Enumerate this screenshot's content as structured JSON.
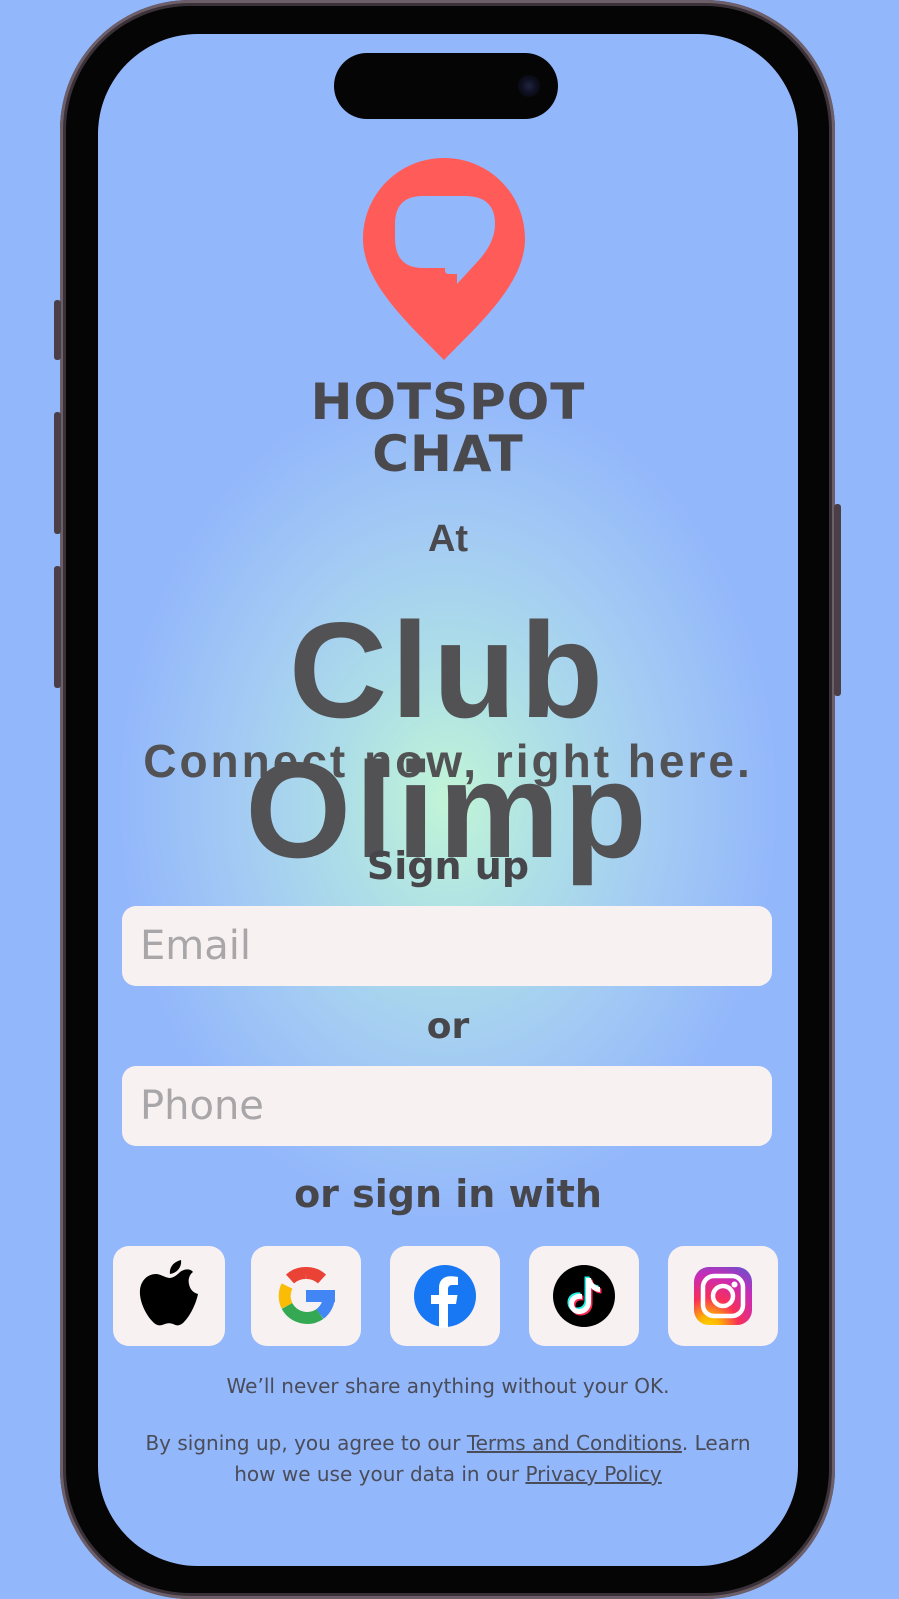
{
  "brand": {
    "line1": "HOTSPOT",
    "line2": "CHAT",
    "pin_color": "#ff5b59"
  },
  "at_label": "At",
  "venue_name": "Club Olimp",
  "tagline": "Connect now, right here.",
  "signup": {
    "heading": "Sign up",
    "email_placeholder": "Email",
    "or_label": "or",
    "phone_placeholder": "Phone",
    "sign_in_with_label": "or sign in with"
  },
  "social_providers": [
    {
      "name": "apple-icon"
    },
    {
      "name": "google-icon"
    },
    {
      "name": "facebook-icon"
    },
    {
      "name": "tiktok-icon"
    },
    {
      "name": "instagram-icon"
    }
  ],
  "privacy_note": "We’ll never share anything without your OK.",
  "legal": {
    "prefix": "By signing up, you agree to our ",
    "terms_link": "Terms and Conditions",
    "middle": ". Learn how we use your data in our ",
    "privacy_link": "Privacy Policy"
  },
  "colors": {
    "background": "#93b7fb",
    "text": "#4a4a4e",
    "field_bg": "#f8f1f2"
  }
}
